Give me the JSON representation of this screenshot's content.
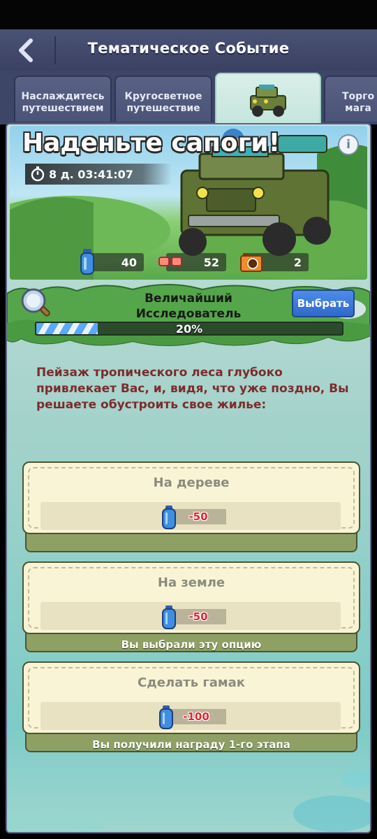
{
  "header": {
    "title": "Тематическое Событие",
    "back_icon": "chevron-left-icon"
  },
  "tabs": [
    {
      "label": "Наслаждитесь путешествием",
      "active": false
    },
    {
      "label": "Кругосветное путешествие",
      "active": false
    },
    {
      "label": "",
      "icon": "jeep-icon",
      "active": true
    },
    {
      "label": "Торго мага",
      "active": false
    }
  ],
  "event": {
    "title": "Наденьте сапоги!",
    "timer": "8 д.  03:41:07",
    "resources": [
      {
        "icon": "water-bottle-icon",
        "value": "40"
      },
      {
        "icon": "goggles-icon",
        "value": "52"
      },
      {
        "icon": "camera-icon",
        "value": "2"
      }
    ]
  },
  "rank": {
    "name": "Величайший Исследователь",
    "progress_percent": 20,
    "progress_text": "20%",
    "choose_label": "Выбрать"
  },
  "story": "Пейзаж тропического леса глубоко привлекает Вас, и, видя, что уже поздно, Вы решаете обустроить свое жилье:",
  "options": [
    {
      "title": "На дереве",
      "cost": "-50",
      "status": ""
    },
    {
      "title": "На земле",
      "cost": "-50",
      "status": "Вы выбрали эту опцию"
    },
    {
      "title": "Сделать гамак",
      "cost": "-100",
      "status": "Вы получили награду 1-го этапа"
    }
  ],
  "colors": {
    "story_text": "#7c2c2e",
    "cost_text": "#e4232e",
    "choose_button": "#3a78da",
    "header_bg": "#434b6e"
  }
}
